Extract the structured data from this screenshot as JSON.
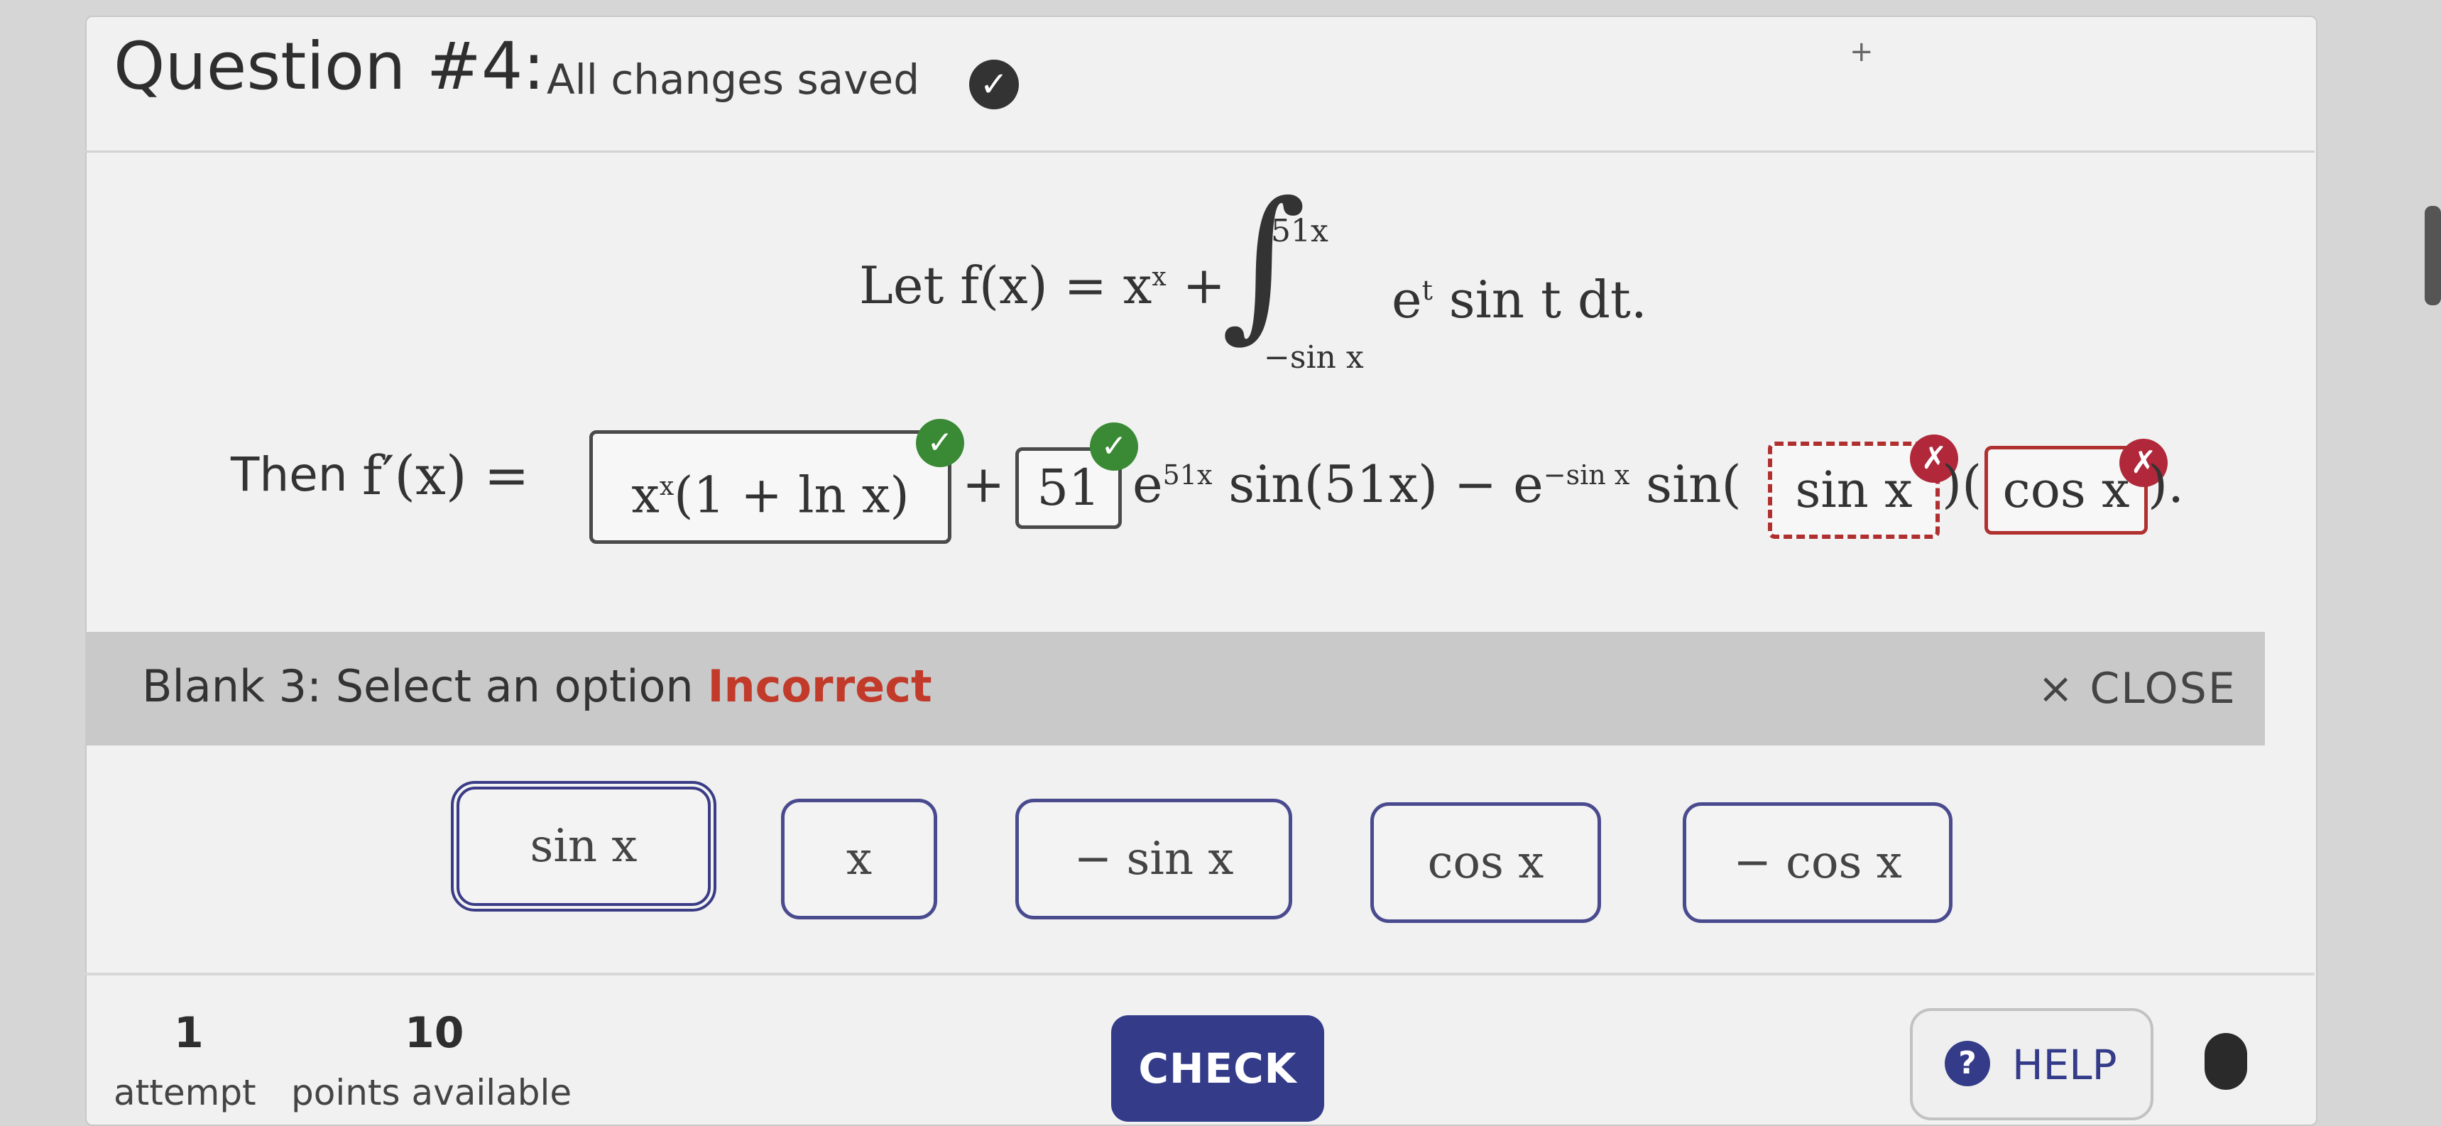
{
  "header": {
    "title": "Question #4:",
    "status": "All changes saved"
  },
  "question": {
    "definition": {
      "prefix": "Let f(x) = x",
      "exp": "x",
      "plus": "+",
      "upper_limit": "51x",
      "lower_limit": "−sin x",
      "integrand": "e",
      "integrand_exp": "t",
      "integrand_rest": "sin t dt."
    },
    "answer_line": {
      "label": "Then",
      "lhs": "f′(x) =",
      "blank1_value": "x",
      "blank1_exp": "x",
      "blank1_rest": "(1 + ln x)",
      "plus": "+",
      "blank2_value": "51",
      "term_e": "e",
      "term_e_exp": "51x",
      "term_sin": "sin(51x) − e",
      "term_e2_exp": "−sin x",
      "term_sin2": "sin(",
      "blank3_value": "sin x",
      "paren_mid": ")(",
      "blank4_value": "cos x",
      "end": ")."
    }
  },
  "feedback": {
    "label": "Blank 3: Select an option",
    "status": "Incorrect",
    "close_label": "× CLOSE"
  },
  "options": [
    "sin x",
    "x",
    "− sin x",
    "cos x",
    "− cos x"
  ],
  "selected_option": "sin x",
  "footer": {
    "attempts_num": "1",
    "attempts_label": "attempt",
    "points_num": "10",
    "points_label": "points available",
    "check_label": "CHECK",
    "help_label": "HELP"
  },
  "colors": {
    "correct": "#3a8a35",
    "incorrect": "#b0283a",
    "primary": "#343c8a"
  }
}
